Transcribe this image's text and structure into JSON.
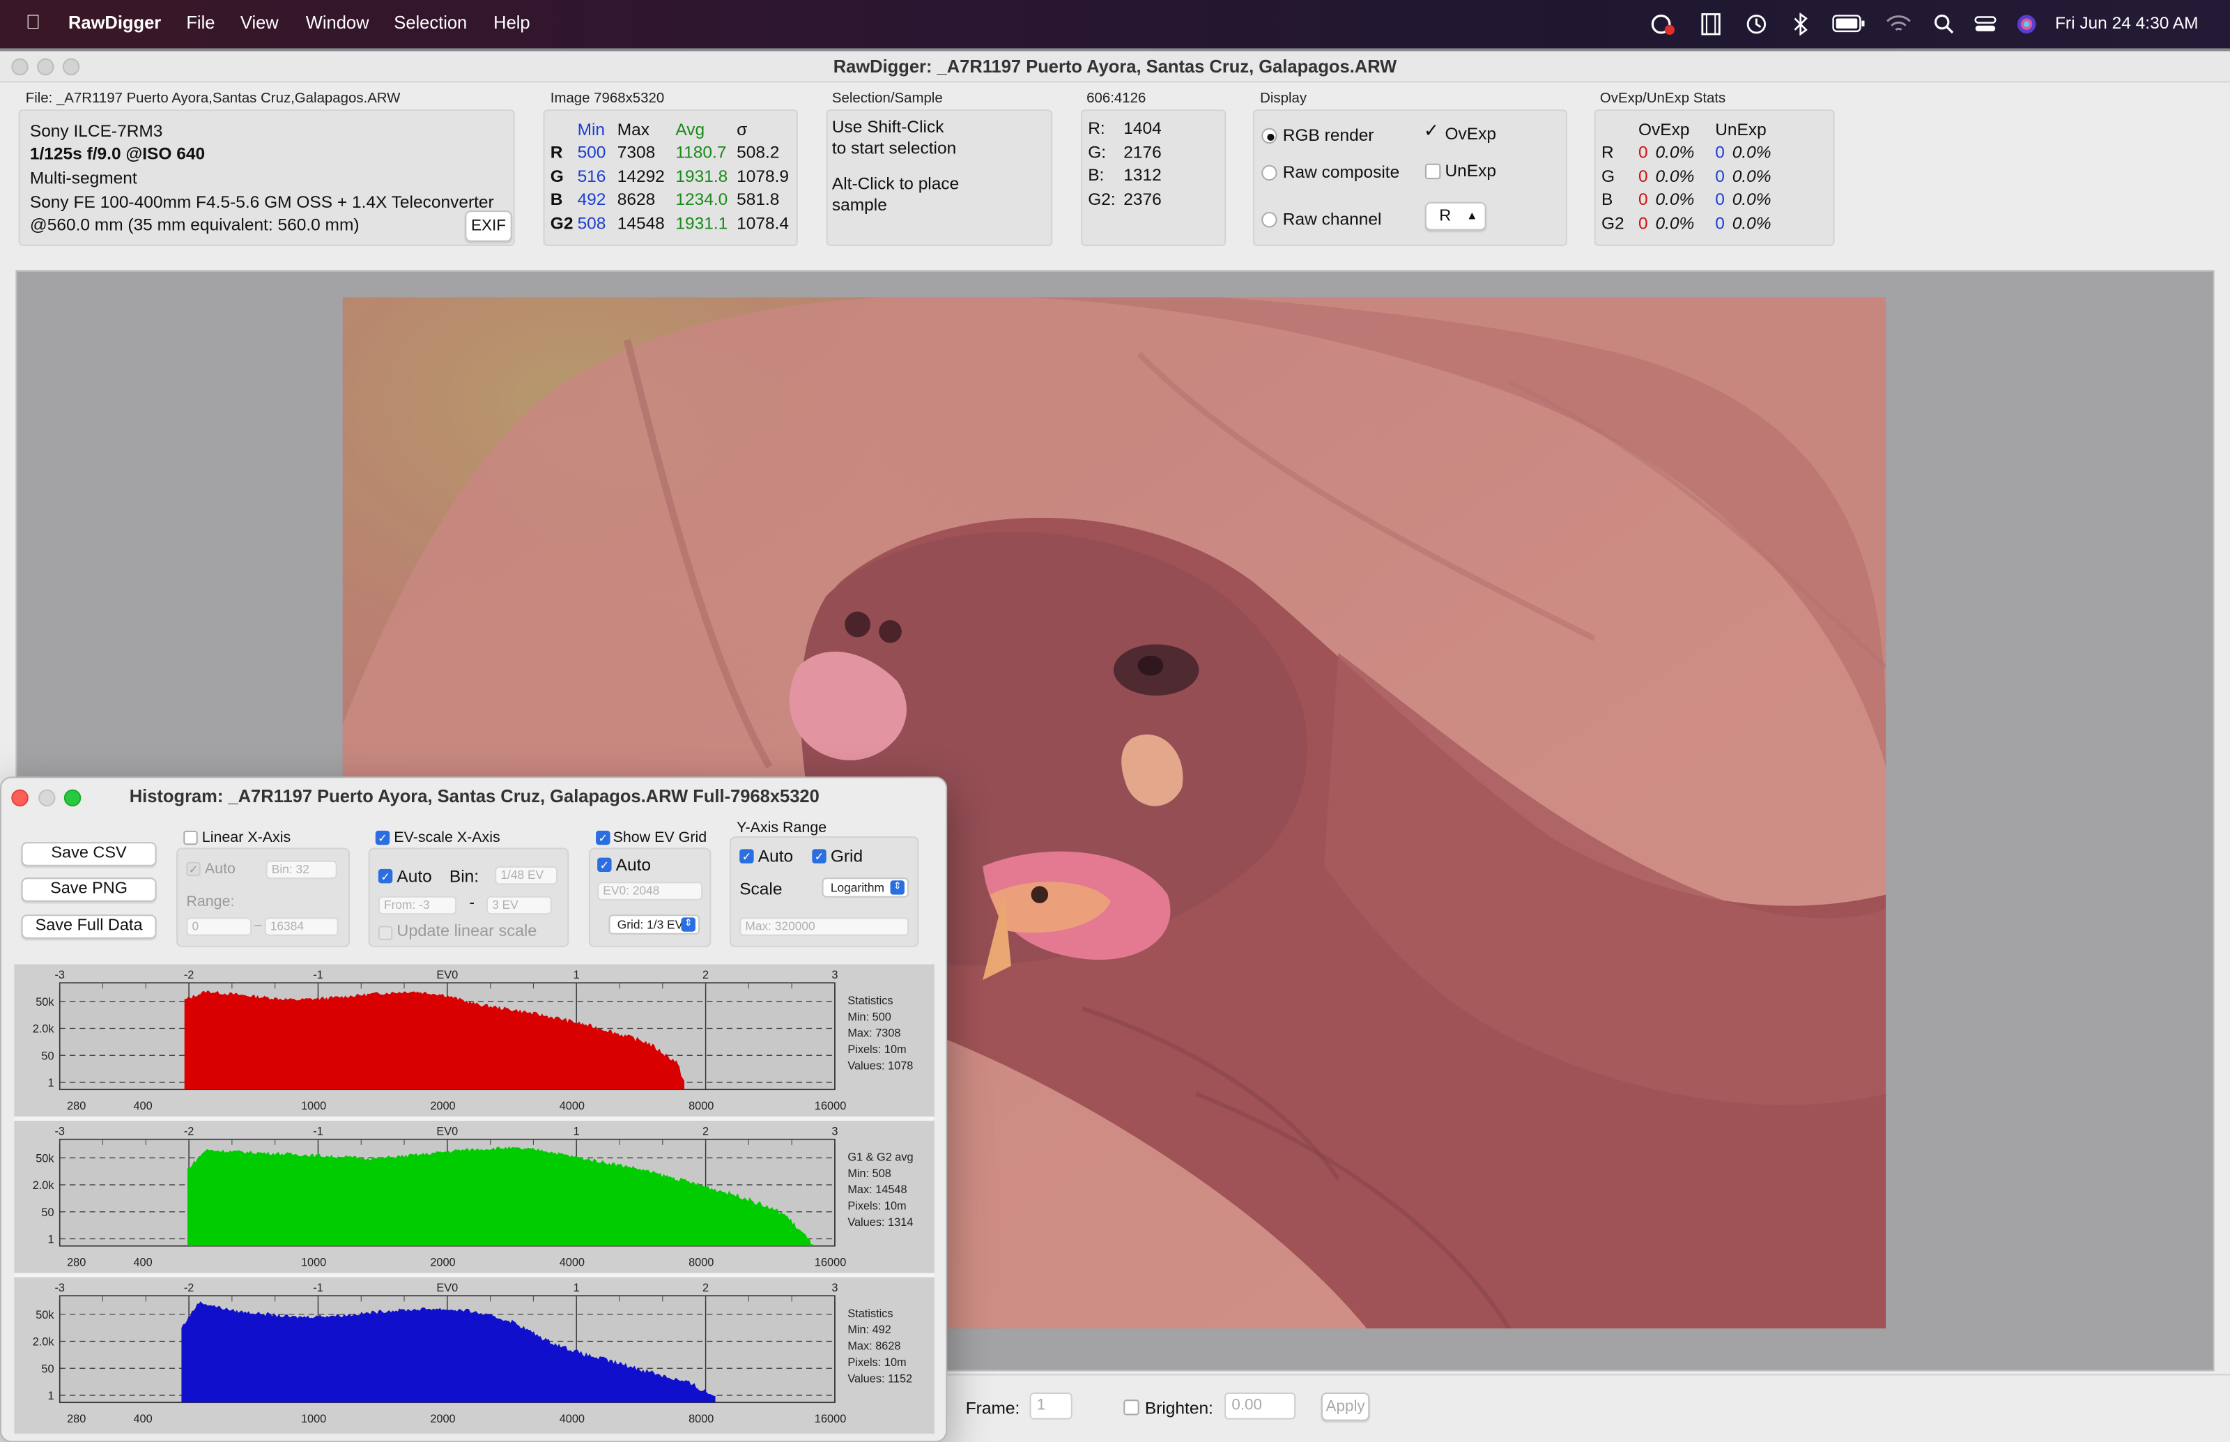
{
  "menubar": {
    "app_name": "RawDigger",
    "items": [
      "File",
      "View",
      "Window",
      "Selection",
      "Help"
    ],
    "datetime": "Fri Jun 24  4:30 AM"
  },
  "window": {
    "title": "RawDigger: _A7R1197 Puerto Ayora, Santas Cruz, Galapagos.ARW"
  },
  "file_panel": {
    "label": "File: _A7R1197 Puerto Ayora,Santas Cruz,Galapagos.ARW",
    "camera": "Sony ILCE-7RM3",
    "exposure": "1/125s f/9.0 @ISO 640",
    "metering": "Multi-segment",
    "lens": "Sony FE 100-400mm F4.5-5.6 GM OSS + 1.4X Teleconverter",
    "focal": "@560.0 mm (35 mm equivalent: 560.0 mm)",
    "exif_button": "EXIF"
  },
  "image_panel": {
    "label": "Image 7968x5320",
    "headers": [
      "Min",
      "Max",
      "Avg",
      "σ"
    ],
    "rows": [
      {
        "ch": "R",
        "min": "500",
        "max": "7308",
        "avg": "1180.7",
        "sd": "508.2"
      },
      {
        "ch": "G",
        "min": "516",
        "max": "14292",
        "avg": "1931.8",
        "sd": "1078.9"
      },
      {
        "ch": "B",
        "min": "492",
        "max": "8628",
        "avg": "1234.0",
        "sd": "581.8"
      },
      {
        "ch": "G2",
        "min": "508",
        "max": "14548",
        "avg": "1931.1",
        "sd": "1078.4"
      }
    ]
  },
  "selection_panel": {
    "label": "Selection/Sample",
    "line1": "Use Shift-Click",
    "line2": "to start selection",
    "line3": "Alt-Click to place",
    "line4": "sample"
  },
  "sample_panel": {
    "label": "606:4126",
    "rows": [
      {
        "ch": "R:",
        "val": "1404"
      },
      {
        "ch": "G:",
        "val": "2176"
      },
      {
        "ch": "B:",
        "val": "1312"
      },
      {
        "ch": "G2:",
        "val": "2376"
      }
    ]
  },
  "display_panel": {
    "label": "Display",
    "rgb_render": "RGB render",
    "raw_composite": "Raw composite",
    "raw_channel": "Raw channel",
    "ovexp": "OvExp",
    "unexp": "UnExp",
    "channel_value": "R",
    "selected_mode": "RGB render",
    "ovexp_checked": true,
    "unexp_checked": false
  },
  "ovexp_panel": {
    "label": "OvExp/UnExp Stats",
    "headers": [
      "OvExp",
      "UnExp"
    ],
    "rows": [
      {
        "ch": "R",
        "ov": "0",
        "ovp": "0.0%",
        "un": "0",
        "unp": "0.0%"
      },
      {
        "ch": "G",
        "ov": "0",
        "ovp": "0.0%",
        "un": "0",
        "unp": "0.0%"
      },
      {
        "ch": "B",
        "ov": "0",
        "ovp": "0.0%",
        "un": "0",
        "unp": "0.0%"
      },
      {
        "ch": "G2",
        "ov": "0",
        "ovp": "0.0%",
        "un": "0",
        "unp": "0.0%"
      }
    ]
  },
  "bottom_bar": {
    "frame_label": "Frame:",
    "frame_value": "1",
    "brighten_label": "Brighten:",
    "brighten_value": "0.00",
    "apply_label": "Apply"
  },
  "histogram": {
    "title": "Histogram: _A7R1197 Puerto Ayora, Santas Cruz, Galapagos.ARW Full-7968x5320",
    "buttons": [
      "Save CSV",
      "Save PNG",
      "Save Full Data"
    ],
    "linear": {
      "label": "Linear X-Axis",
      "auto": "Auto",
      "bin": "Bin: 32",
      "range": "Range:",
      "from": "0",
      "to": "16384"
    },
    "ev": {
      "label": "EV-scale X-Axis",
      "auto": "Auto",
      "bin_label": "Bin:",
      "bin": "1/48 EV",
      "from": "From: -3",
      "to": "3 EV",
      "update": "Update linear scale"
    },
    "evgrid": {
      "label": "Show EV Grid",
      "auto": "Auto",
      "ev0": "EV0: 2048",
      "grid": "Grid: 1/3 EV"
    },
    "yaxis": {
      "label": "Y-Axis Range",
      "auto": "Auto",
      "grid": "Grid",
      "scale": "Scale",
      "scale_value": "Logarithm",
      "max": "Max: 320000"
    },
    "top_ticks": [
      "-3",
      "-2",
      "-1",
      "EV0",
      "1",
      "2",
      "3"
    ],
    "bottom_ticks": [
      "280",
      "400",
      "1000",
      "2000",
      "4000",
      "8000",
      "16000"
    ],
    "y_ticks": [
      "50k",
      "2.0k",
      "50",
      "1"
    ],
    "plots": [
      {
        "name": "R",
        "color": "#d80000",
        "stats": [
          "Statistics",
          "Min: 500",
          "Max: 7308",
          "Pixels: 10m",
          "Values: 1078"
        ]
      },
      {
        "name": "G",
        "color": "#00cc00",
        "stats": [
          "G1 & G2 avg",
          "Min: 508",
          "Max: 14548",
          "Pixels: 10m",
          "Values: 1314"
        ]
      },
      {
        "name": "B",
        "color": "#1010cc",
        "stats": [
          "Statistics",
          "Min: 492",
          "Max: 8628",
          "Pixels: 10m",
          "Values: 1152"
        ]
      }
    ]
  },
  "chart_data": {
    "type": "area",
    "xscale": "log",
    "x_ticks": [
      280,
      400,
      1000,
      2000,
      4000,
      8000,
      16000
    ],
    "ev_ticks": [
      "-3",
      "-2",
      "-1",
      "EV0",
      "1",
      "2",
      "3"
    ],
    "y_ticks": [
      "50k",
      "2.0k",
      "50",
      "1"
    ],
    "yscale": "log",
    "grid": true,
    "series": [
      {
        "name": "R",
        "min": 500,
        "max": 7308,
        "x": [
          500,
          560,
          700,
          900,
          1100,
          1400,
          1700,
          2000,
          2400,
          3000,
          3800,
          4800,
          6000,
          7000,
          7308
        ],
        "level": [
          0.84,
          0.92,
          0.88,
          0.84,
          0.86,
          0.9,
          0.92,
          0.89,
          0.8,
          0.74,
          0.66,
          0.56,
          0.44,
          0.26,
          0.08
        ]
      },
      {
        "name": "G1 & G2 avg",
        "min": 508,
        "max": 14548,
        "x": [
          508,
          560,
          700,
          900,
          1100,
          1400,
          1800,
          2200,
          2800,
          3400,
          4000,
          5500,
          7500,
          10000,
          12500,
          14548
        ],
        "level": [
          0.72,
          0.9,
          0.88,
          0.86,
          0.84,
          0.82,
          0.86,
          0.9,
          0.92,
          0.9,
          0.84,
          0.74,
          0.6,
          0.46,
          0.3,
          0.02
        ]
      },
      {
        "name": "B",
        "min": 492,
        "max": 8628,
        "x": [
          492,
          540,
          650,
          900,
          1200,
          1500,
          1900,
          2300,
          2900,
          3500,
          4200,
          5000,
          6200,
          7500,
          8628
        ],
        "level": [
          0.7,
          0.94,
          0.86,
          0.8,
          0.82,
          0.86,
          0.88,
          0.86,
          0.76,
          0.58,
          0.46,
          0.38,
          0.28,
          0.18,
          0.06
        ]
      }
    ]
  },
  "colors": {
    "accent": "#2a6ee0",
    "min_col": "#1d3fd0",
    "avg_col": "#1a8a1a",
    "ov_col": "#d01010"
  }
}
